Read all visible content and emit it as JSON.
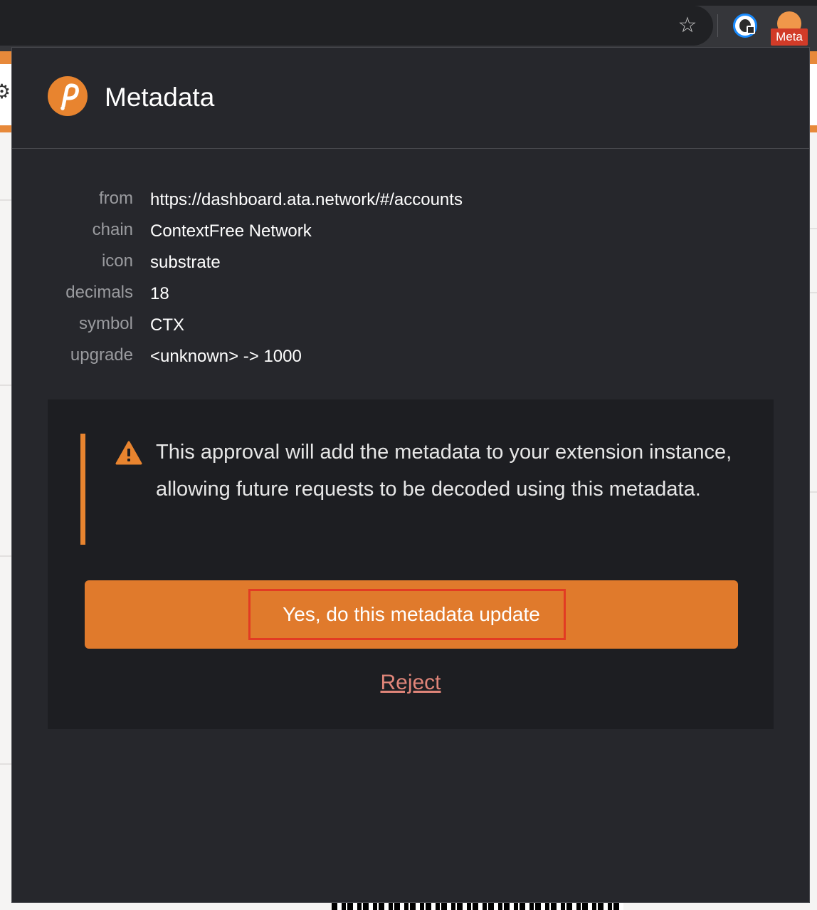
{
  "browser": {
    "star_icon": "star-icon",
    "extensions": [
      {
        "name": "1password-extension",
        "icon": "1password-icon"
      },
      {
        "name": "polkadot-extension",
        "icon": "polkadot-icon",
        "badge": "Meta"
      }
    ]
  },
  "popup": {
    "title": "Metadata",
    "logo_icon": "polkadot-logo",
    "fields": [
      {
        "key": "from",
        "value": "https://dashboard.ata.network/#/accounts"
      },
      {
        "key": "chain",
        "value": "ContextFree Network"
      },
      {
        "key": "icon",
        "value": "substrate"
      },
      {
        "key": "decimals",
        "value": "18"
      },
      {
        "key": "symbol",
        "value": "CTX"
      },
      {
        "key": "upgrade",
        "value": "<unknown> -> 1000"
      }
    ],
    "warning": {
      "icon": "warning-icon",
      "text": "This approval will add the metadata to your extension instance, allowing future requests to be decoded using this metadata."
    },
    "approve_label": "Yes, do this metadata update",
    "reject_label": "Reject"
  },
  "colors": {
    "accent": "#e07a2c",
    "popup_bg": "#26272c",
    "panel_bg": "#1d1e22",
    "reject": "#e08579",
    "highlight": "#e23b23",
    "badge": "#d13b28"
  }
}
